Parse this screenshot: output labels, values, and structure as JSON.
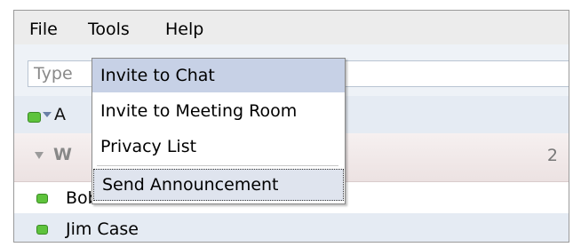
{
  "menubar": {
    "items": [
      {
        "label": "File"
      },
      {
        "label": "Tools"
      },
      {
        "label": "Help"
      }
    ]
  },
  "search": {
    "value": "Type"
  },
  "status": {
    "label": "A",
    "color": "#5ec33c"
  },
  "group": {
    "label": "W",
    "count": "2"
  },
  "contacts": [
    {
      "name": "Bob Martin",
      "status_color": "#5ec33c"
    },
    {
      "name": "Jim Case",
      "status_color": "#5ec33c"
    }
  ],
  "tools_menu": {
    "items": [
      {
        "label": "Invite to Chat",
        "highlighted": true
      },
      {
        "label": "Invite to Meeting Room"
      },
      {
        "label": "Privacy List"
      },
      {
        "label": "Send Announcement",
        "focused": true
      }
    ]
  }
}
